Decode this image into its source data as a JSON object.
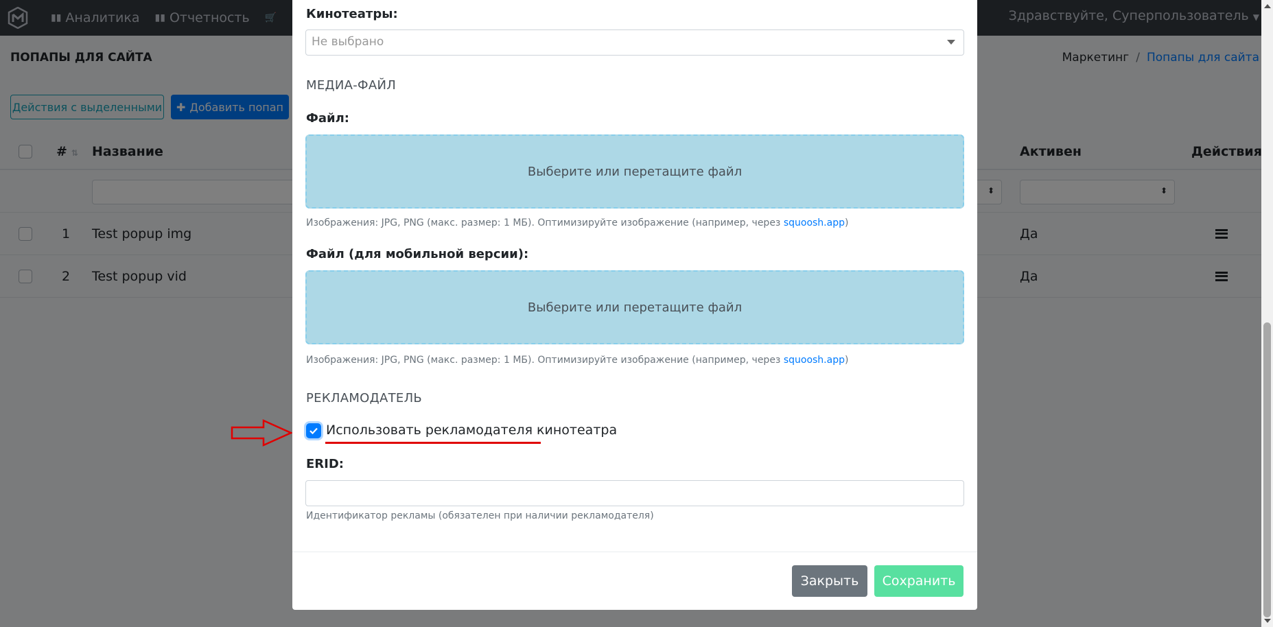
{
  "nav": {
    "items": [
      {
        "label": "Аналитика",
        "icon": "bar-chart-icon"
      },
      {
        "label": "Отчетность",
        "icon": "bar-chart-icon"
      }
    ],
    "greeting": "Здравствуйте, Суперпользователь"
  },
  "page": {
    "title": "ПОПАПЫ ДЛЯ САЙТА",
    "breadcrumb": [
      "Маркетинг",
      "Попапы для сайта"
    ]
  },
  "actions": {
    "bulk_label": "Действия с выделенными",
    "add_label": "Добавить попап"
  },
  "table": {
    "headers": {
      "num": "#",
      "name": "Название",
      "active": "Активен",
      "actions": "Действия"
    },
    "rows": [
      {
        "num": "1",
        "name": "Test popup img",
        "active": "Да"
      },
      {
        "num": "2",
        "name": "Test popup vid",
        "active": "Да"
      }
    ]
  },
  "modal": {
    "cinemas_label": "Кинотеатры:",
    "cinemas_value": "Не выбрано",
    "media_section": "МЕДИА-ФАЙЛ",
    "file_label": "Файл:",
    "dropzone_text": "Выберите или перетащите файл",
    "help_prefix": "Изображения: JPG, PNG (макс. размер: 1 МБ). Оптимизируйте изображение (например, через ",
    "help_link": "squoosh.app",
    "help_suffix": ")",
    "file_mobile_label": "Файл (для мобильной версии):",
    "advertiser_section": "РЕКЛАМОДАТЕЛЬ",
    "use_advertiser_label": "Использовать рекламодателя кинотеатра",
    "use_advertiser_checked": true,
    "erid_label": "ERID:",
    "erid_value": "",
    "erid_help": "Идентификатор рекламы (обязателен при наличии рекламодателя)",
    "close_label": "Закрыть",
    "save_label": "Сохранить"
  },
  "colors": {
    "nav_bg": "#343a40",
    "primary": "#007bff",
    "dropzone": "#add8e6",
    "save": "#58e0a0",
    "annotation": "#e00000"
  }
}
